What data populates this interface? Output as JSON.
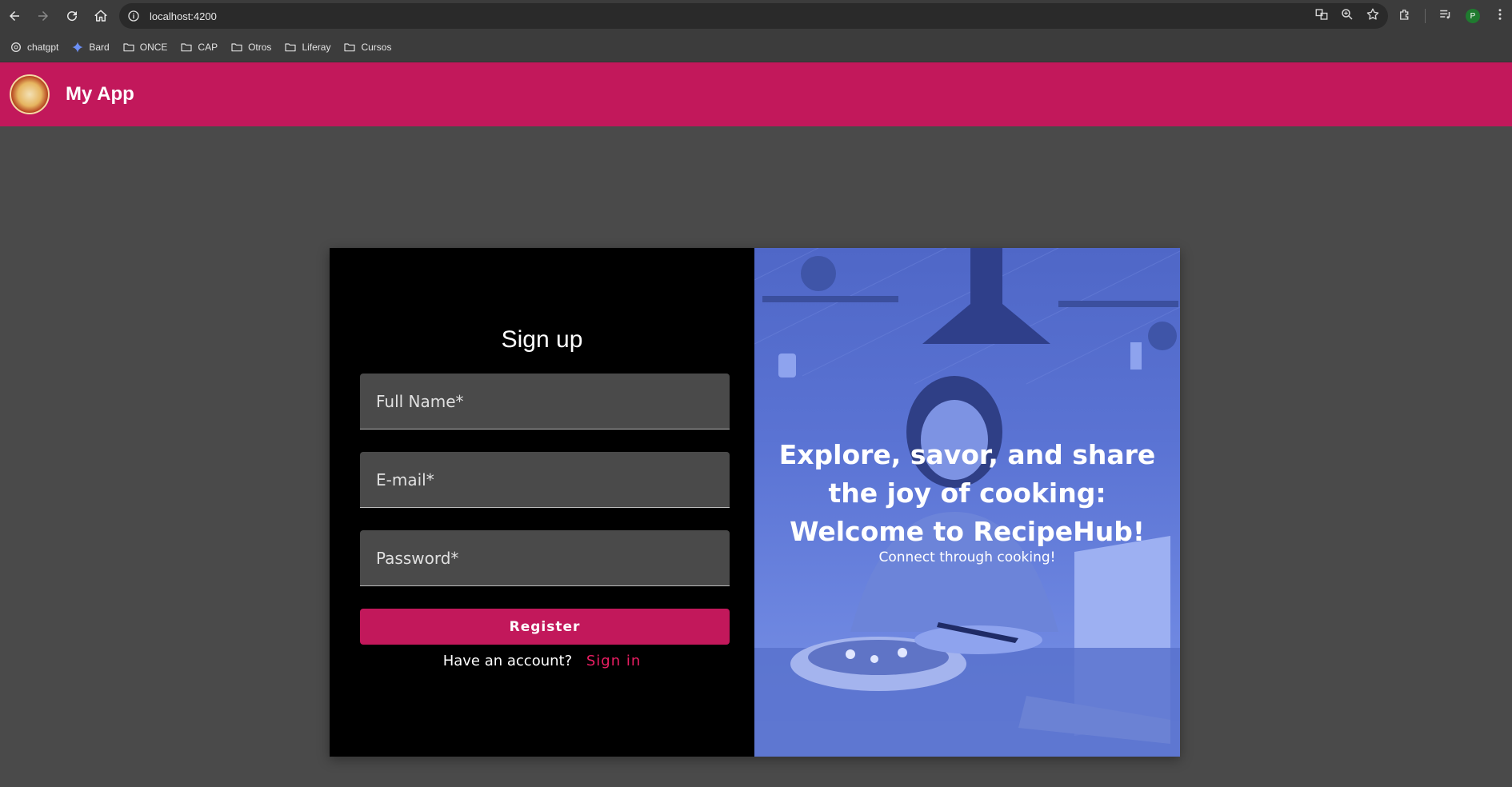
{
  "browser": {
    "url": "localhost:4200",
    "profile_initial": "P",
    "bookmarks": [
      {
        "label": "chatgpt",
        "icon": "chatgpt-icon"
      },
      {
        "label": "Bard",
        "icon": "bard-sparkle-icon"
      },
      {
        "label": "ONCE",
        "icon": "folder-icon"
      },
      {
        "label": "CAP",
        "icon": "folder-icon"
      },
      {
        "label": "Otros",
        "icon": "folder-icon"
      },
      {
        "label": "Liferay",
        "icon": "folder-icon"
      },
      {
        "label": "Cursos",
        "icon": "folder-icon"
      }
    ]
  },
  "app": {
    "title": "My App",
    "accent_color": "#c2185b"
  },
  "signup": {
    "title": "Sign up",
    "fields": {
      "full_name": {
        "placeholder": "Full Name*",
        "value": ""
      },
      "email": {
        "placeholder": "E-mail*",
        "value": ""
      },
      "password": {
        "placeholder": "Password*",
        "value": ""
      }
    },
    "register_label": "Register",
    "have_account_text": "Have an account?",
    "sign_in_label": "Sign in"
  },
  "hero": {
    "headline": "Explore, savor, and share the joy of cooking: Welcome to RecipeHub!",
    "subtitle": "Connect through cooking!"
  }
}
